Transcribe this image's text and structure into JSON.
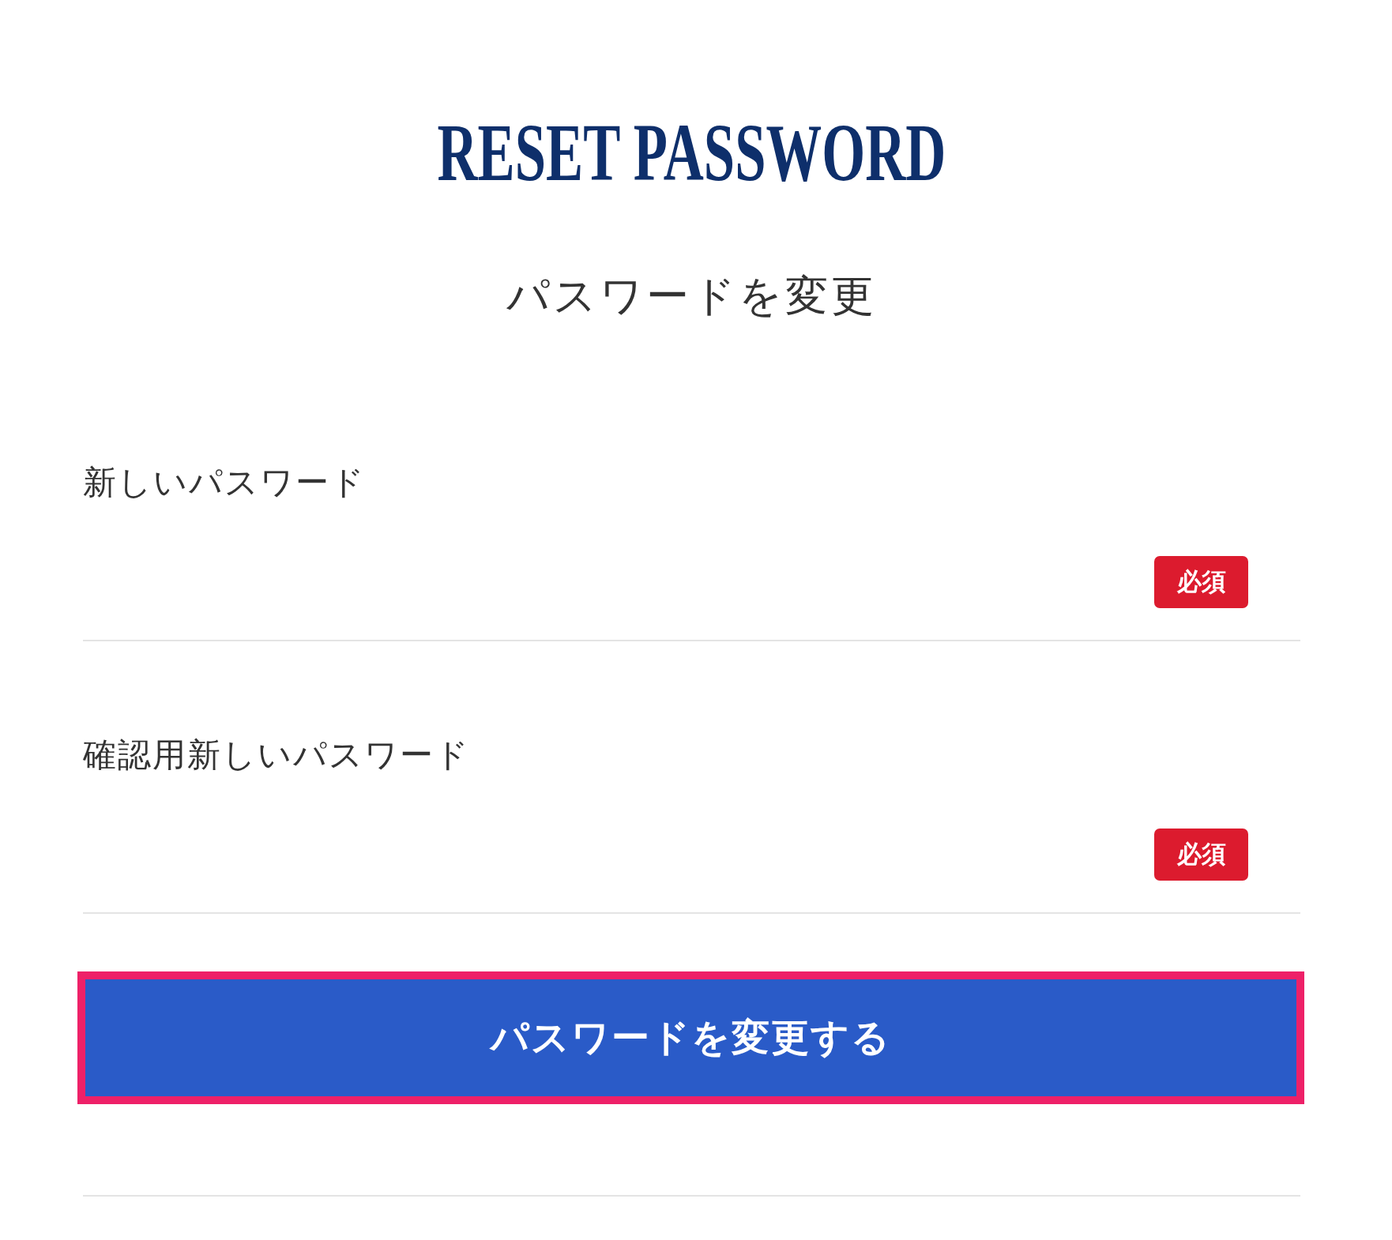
{
  "title": "RESET PASSWORD",
  "subtitle": "パスワードを変更",
  "fields": [
    {
      "label": "新しいパスワード",
      "badge": "必須"
    },
    {
      "label": "確認用新しいパスワード",
      "badge": "必須"
    }
  ],
  "submit_button": {
    "label": "パスワードを変更する",
    "highlighted": true
  }
}
